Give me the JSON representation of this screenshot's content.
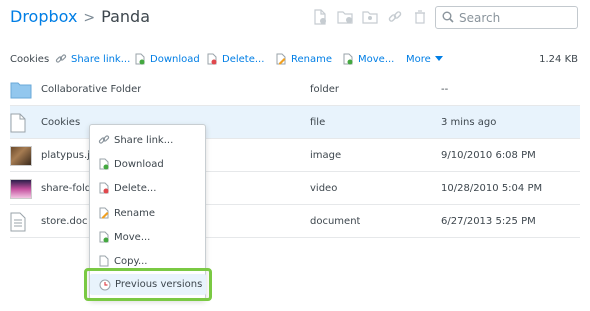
{
  "breadcrumb": {
    "root": "Dropbox",
    "separator": ">",
    "current": "Panda"
  },
  "header_icons": [
    "new-file-icon",
    "new-folder-icon",
    "shared-folder-icon",
    "link-icon",
    "trash-icon"
  ],
  "search": {
    "placeholder": "Search"
  },
  "toolbar": {
    "selected_name": "Cookies",
    "share_link": "Share link...",
    "download": "Download",
    "delete": "Delete...",
    "rename": "Rename",
    "move": "Move...",
    "more": "More",
    "size": "1.24 KB"
  },
  "files": [
    {
      "name": "Collaborative Folder",
      "kind": "folder",
      "modified": "--",
      "icon": "folder-icon"
    },
    {
      "name": "Cookies",
      "kind": "file",
      "modified": "3 mins ago",
      "icon": "file-icon"
    },
    {
      "name": "platypus.jpg",
      "kind": "image",
      "modified": "9/10/2010 6:08 PM",
      "icon": "image-thumbnail"
    },
    {
      "name": "share-folder",
      "kind": "video",
      "modified": "10/28/2010 5:04 PM",
      "icon": "video-thumbnail"
    },
    {
      "name": "store.doc",
      "kind": "document",
      "modified": "6/27/2013 5:25 PM",
      "icon": "document-icon"
    }
  ],
  "context_menu": {
    "share_link": "Share link...",
    "download": "Download",
    "delete": "Delete...",
    "rename": "Rename",
    "move": "Move...",
    "copy": "Copy...",
    "previous_versions": "Previous versions"
  },
  "colors": {
    "link": "#007ee5",
    "selected_row": "#e8f3fc",
    "highlight_border": "#7ac943"
  }
}
